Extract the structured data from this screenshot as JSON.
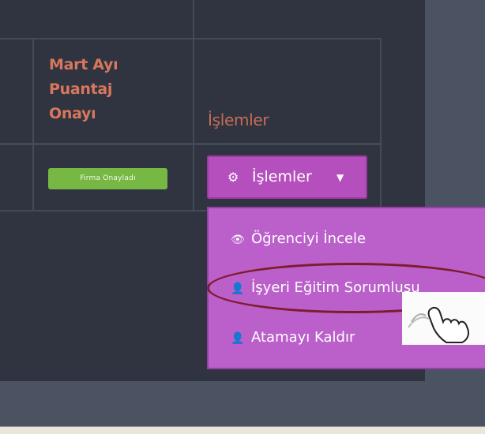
{
  "table": {
    "headers": {
      "mart_puantaj": [
        "Mart Ayı",
        "Puantaj",
        "Onayı"
      ],
      "islemler": "İşlemler"
    },
    "row": {
      "status_badge": "Firma Onayladı",
      "action_button": {
        "icon": "cogs-icon",
        "label": "İşlemler",
        "caret": "▼"
      }
    }
  },
  "dropdown": {
    "items": [
      {
        "icon": "eye-icon",
        "label": "Öğrenciyi İncele"
      },
      {
        "icon": "user-icon",
        "label": "İşyeri Eğitim Sorumlusu"
      },
      {
        "icon": "user-icon",
        "label": "Atamayı Kaldır"
      }
    ]
  },
  "colors": {
    "panel_bg": "#2f3440",
    "header_text": "#d9775d",
    "badge_green": "#76b843",
    "button_purple": "#b54fbd",
    "menu_purple": "#bb5fcb",
    "highlight_ellipse": "#7d1d2b"
  },
  "cursor": {
    "icon": "hand-pointer-icon"
  }
}
